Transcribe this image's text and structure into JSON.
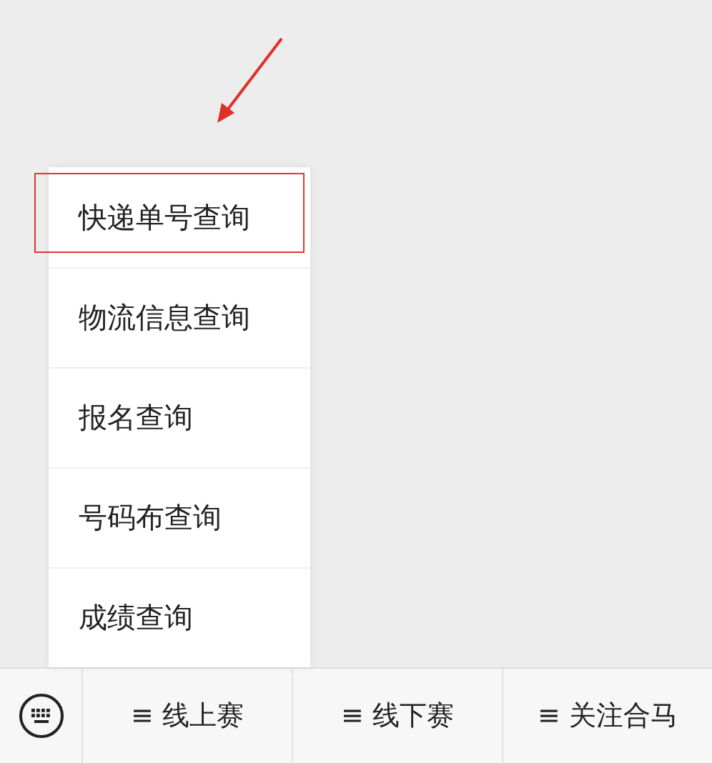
{
  "menu": {
    "items": [
      {
        "label": "快递单号查询",
        "highlighted": true
      },
      {
        "label": "物流信息查询",
        "highlighted": false
      },
      {
        "label": "报名查询",
        "highlighted": false
      },
      {
        "label": "号码布查询",
        "highlighted": false
      },
      {
        "label": "成绩查询",
        "highlighted": false
      }
    ]
  },
  "bottom_bar": {
    "tabs": [
      {
        "icon": "≡",
        "label": "线上赛"
      },
      {
        "icon": "≡",
        "label": "线下赛"
      },
      {
        "icon": "≡",
        "label": "关注合马"
      }
    ]
  }
}
